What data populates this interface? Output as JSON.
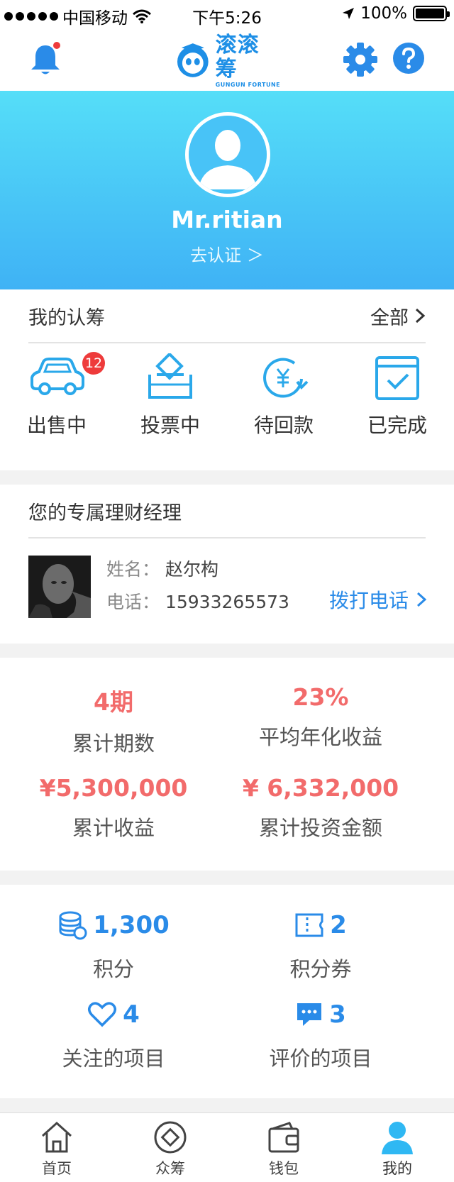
{
  "status_bar": {
    "carrier": "中国移动",
    "time": "下午5:26",
    "battery": "100%"
  },
  "header": {
    "logo_text": "滚滚筹",
    "logo_sub": "GUNGUN FORTUNE"
  },
  "profile": {
    "username": "Mr.ritian",
    "verify_link": "去认证"
  },
  "subscriptions": {
    "title": "我的认筹",
    "all_link": "全部",
    "items": [
      {
        "label": "出售中",
        "icon": "car-icon",
        "badge": "12"
      },
      {
        "label": "投票中",
        "icon": "vote-box-icon"
      },
      {
        "label": "待回款",
        "icon": "yen-return-icon"
      },
      {
        "label": "已完成",
        "icon": "calendar-check-icon"
      }
    ]
  },
  "manager": {
    "title": "您的专属理财经理",
    "name_label": "姓名：",
    "name": "赵尔构",
    "phone_label": "电话：",
    "phone": "15933265573",
    "call_link": "拨打电话"
  },
  "stats": {
    "periods_value": "4期",
    "periods_label": "累计期数",
    "yield_value": "23%",
    "yield_label": "平均年化收益",
    "income_value": "¥5,300,000",
    "income_label": "累计收益",
    "invest_value": "¥ 6,332,000",
    "invest_label": "累计投资金额"
  },
  "points": {
    "points_value": "1,300",
    "points_label": "积分",
    "coupons_value": "2",
    "coupons_label": "积分券",
    "follows_value": "4",
    "follows_label": "关注的项目",
    "reviews_value": "3",
    "reviews_label": "评价的项目"
  },
  "tabbar": {
    "items": [
      {
        "label": "首页",
        "icon": "home-icon"
      },
      {
        "label": "众筹",
        "icon": "crowdfund-icon"
      },
      {
        "label": "钱包",
        "icon": "wallet-icon"
      },
      {
        "label": "我的",
        "icon": "user-icon",
        "active": true
      }
    ]
  },
  "colors": {
    "accent": "#2a8be8",
    "highlight": "#f26b6b",
    "badge": "#ee3b3b",
    "hero_top": "#55def8",
    "hero_bottom": "#3fb2f5"
  }
}
